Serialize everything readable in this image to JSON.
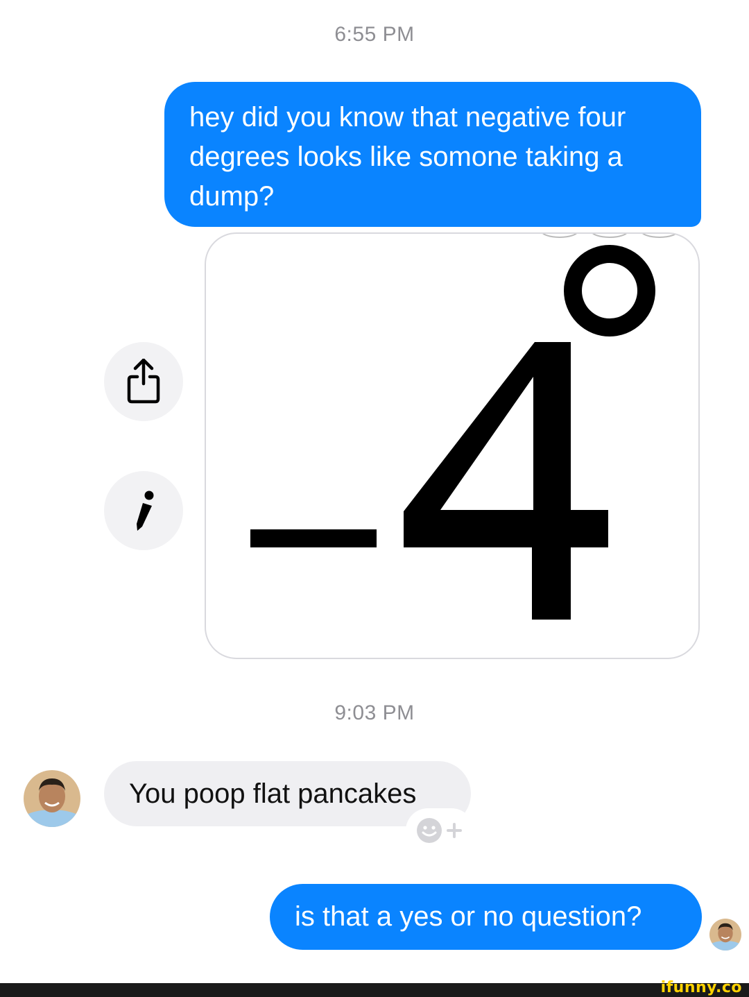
{
  "conversation": {
    "timestamps": [
      "6:55 PM",
      "9:03 PM"
    ],
    "messages": [
      {
        "from": "me",
        "text": "hey did you know that negative four degrees looks like somone taking a dump?"
      },
      {
        "from": "me",
        "type": "image",
        "image_text": "-4°"
      },
      {
        "from": "them",
        "text": "You poop flat pancakes"
      },
      {
        "from": "me",
        "text": "is that a yes or no question?"
      }
    ]
  },
  "actions": {
    "share_icon": "share-icon",
    "edit_icon": "pencil-icon",
    "reaction_icon": "add-reaction-icon"
  },
  "colors": {
    "outgoing_bubble": "#0a84ff",
    "incoming_bubble": "#efeff2",
    "timestamp": "#8e8e93"
  },
  "watermark": "ifunny.co"
}
